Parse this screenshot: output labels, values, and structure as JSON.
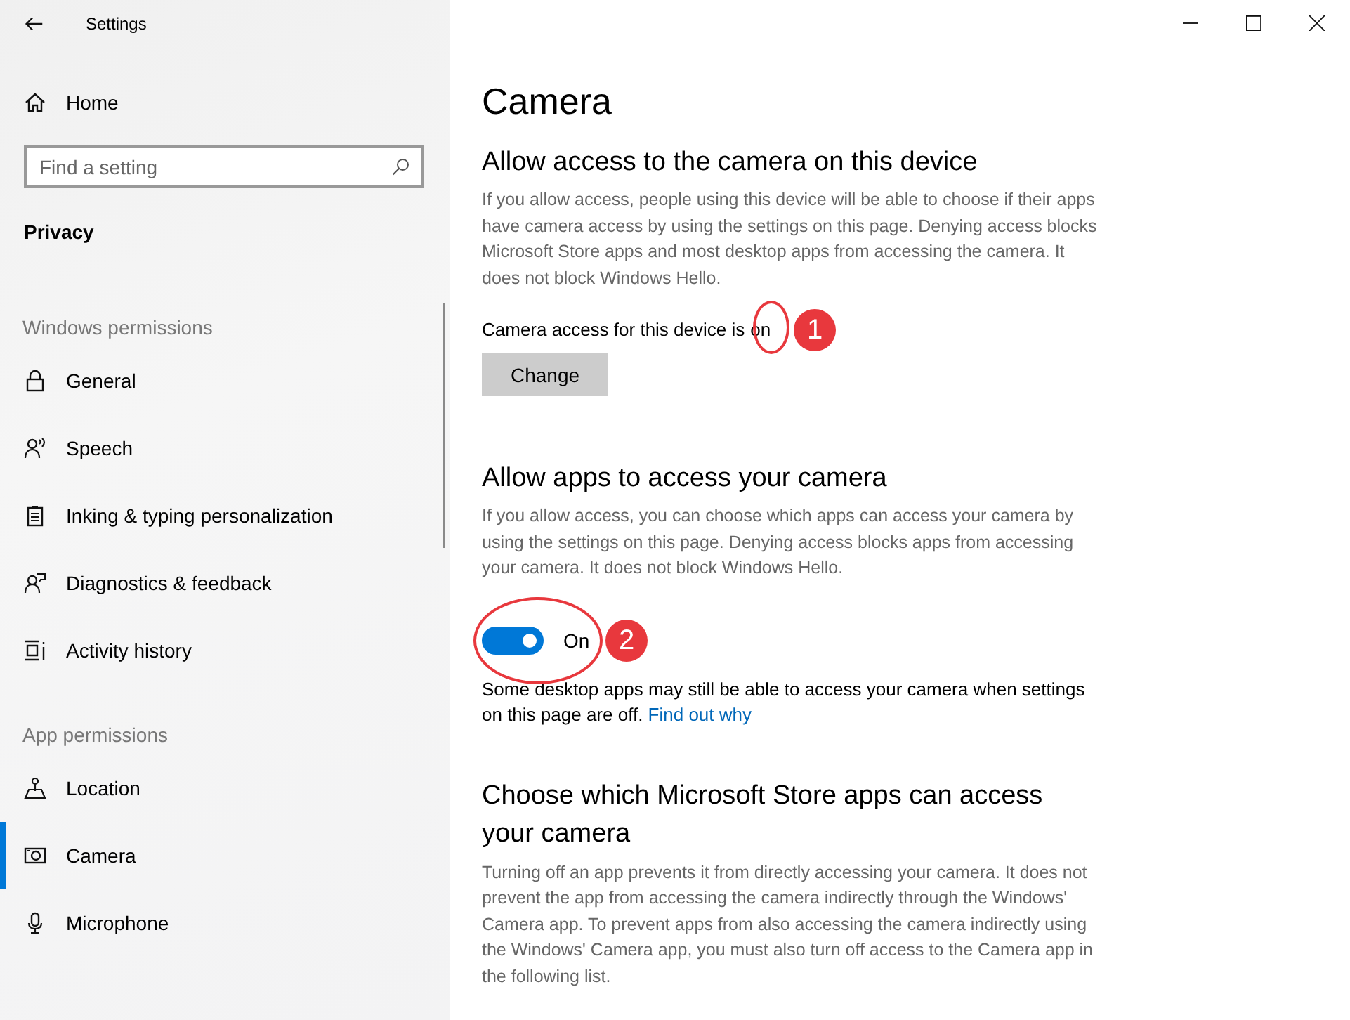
{
  "window": {
    "title": "Settings"
  },
  "sidebar": {
    "home": "Home",
    "search": {
      "placeholder": "Find a setting"
    },
    "section_title": "Privacy",
    "groups": [
      {
        "heading": "Windows permissions",
        "items": [
          {
            "label": "General",
            "kind": "lock",
            "selected": false
          },
          {
            "label": "Speech",
            "kind": "speech",
            "selected": false
          },
          {
            "label": "Inking & typing personalization",
            "kind": "clipboard",
            "selected": false
          },
          {
            "label": "Diagnostics & feedback",
            "kind": "feedback",
            "selected": false
          },
          {
            "label": "Activity history",
            "kind": "history",
            "selected": false
          }
        ]
      },
      {
        "heading": "App permissions",
        "items": [
          {
            "label": "Location",
            "kind": "location",
            "selected": false
          },
          {
            "label": "Camera",
            "kind": "camera",
            "selected": true
          },
          {
            "label": "Microphone",
            "kind": "microphone",
            "selected": false
          }
        ]
      }
    ]
  },
  "page": {
    "title": "Camera",
    "device_section": {
      "heading": "Allow access to the camera on this device",
      "description": "If you allow access, people using this device will be able to choose if their apps have camera access by using the settings on this page. Denying access blocks Microsoft Store apps and most desktop apps from accessing the camera. It does not block Windows Hello.",
      "status_text": "Camera access for this device is",
      "status_value": "on",
      "annotation": "1",
      "button": "Change"
    },
    "apps_section": {
      "heading": "Allow apps to access your camera",
      "description": "If you allow access, you can choose which apps can access your camera by using the settings on this page. Denying access blocks apps from accessing your camera. It does not block Windows Hello.",
      "toggle": {
        "on": true,
        "label": "On"
      },
      "annotation": "2",
      "note": "Some desktop apps may still be able to access your camera when settings on this page are off.",
      "link": "Find out why"
    },
    "store_section": {
      "heading": "Choose which Microsoft Store apps can access your camera",
      "description": "Turning off an app prevents it from directly accessing your camera. It does not prevent the app from accessing the camera indirectly through the Windows' Camera app. To prevent apps from also accessing the camera indirectly using the Windows' Camera app, you must also turn off access to the Camera app in the following list."
    }
  }
}
